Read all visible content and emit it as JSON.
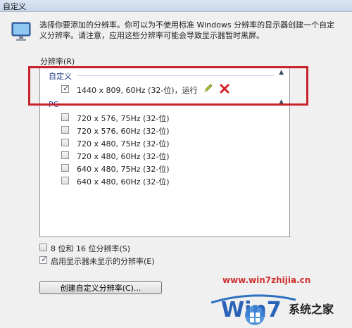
{
  "window": {
    "title": "自定义"
  },
  "intro": {
    "text": "选择你要添加的分辨率。你可以为不使用标准 Windows 分辨率的显示器创建一个自定义分辨率。请注意，应用这些分辨率可能会导致显示器暂时黑屏。"
  },
  "resolution_list": {
    "label": "分辨率(R)",
    "groups": [
      {
        "title": "自定义",
        "items": [
          {
            "label": "1440 x 809, 60Hz (32-位)，运行",
            "checked": true
          }
        ]
      },
      {
        "title": "PC",
        "items": [
          {
            "label": "720 x 576, 75Hz (32-位)",
            "checked": false
          },
          {
            "label": "720 x 576, 60Hz (32-位)",
            "checked": false
          },
          {
            "label": "720 x 480, 75Hz (32-位)",
            "checked": false
          },
          {
            "label": "720 x 480, 60Hz (32-位)",
            "checked": false
          },
          {
            "label": "640 x 480, 75Hz (32-位)",
            "checked": false
          },
          {
            "label": "640 x 480, 60Hz (32-位)",
            "checked": false
          }
        ]
      }
    ]
  },
  "options": {
    "bit_depth": {
      "label": "8 位和 16 位分辨率(S)",
      "checked": false
    },
    "unshown": {
      "label": "启用显示器未显示的分辨率(E)",
      "checked": true
    }
  },
  "create_button": {
    "label": "创建自定义分辨率(C)..."
  },
  "watermark": {
    "url": "www.win7zhijia.cn",
    "brand": "系统之家"
  },
  "colors": {
    "highlight": "#c8222a",
    "group_header": "#1c3c8c"
  }
}
